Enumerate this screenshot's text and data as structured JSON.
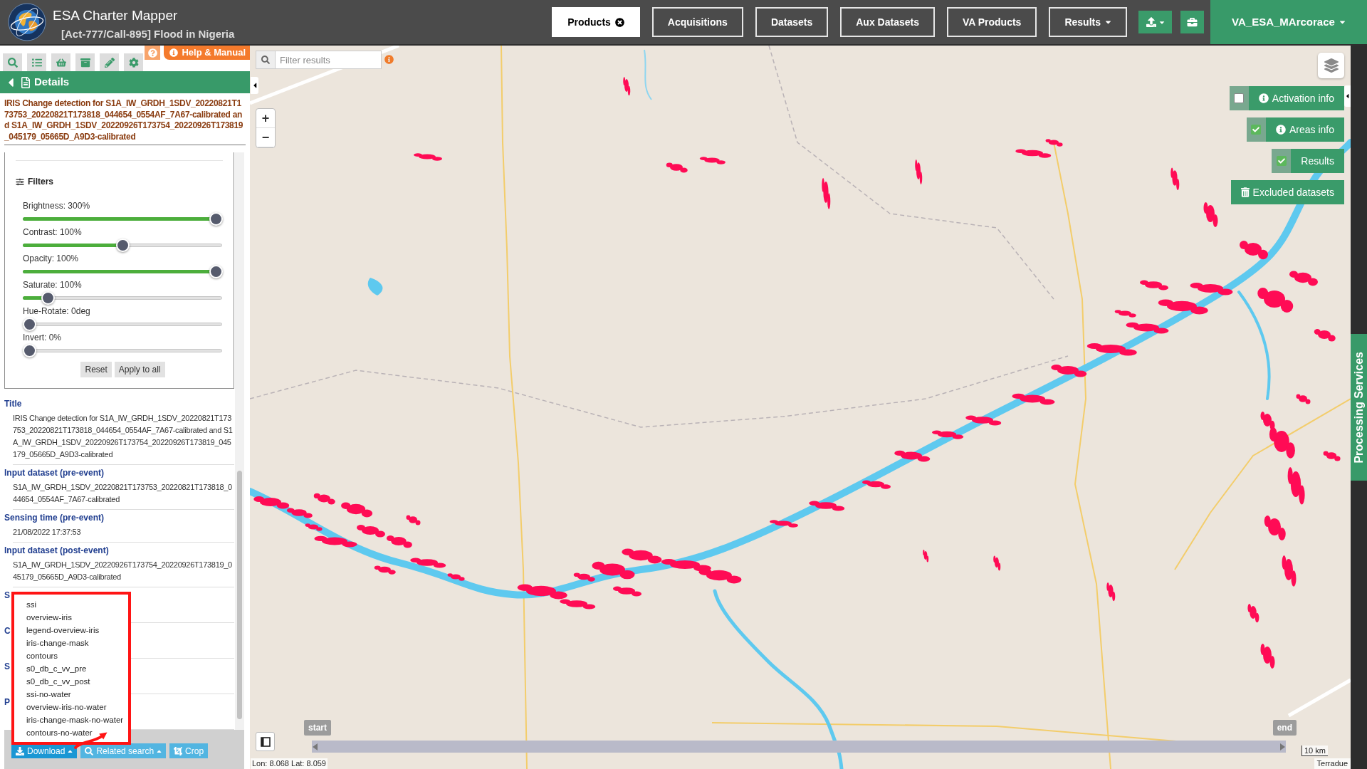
{
  "header": {
    "title": "ESA Charter Mapper",
    "subtitle": "[Act-777/Call-895] Flood in Nigeria"
  },
  "nav": [
    {
      "label": "Products",
      "selected": true,
      "kind": "closable"
    },
    {
      "label": "Acquisitions",
      "selected": false,
      "kind": "tab"
    },
    {
      "label": "Datasets",
      "selected": false,
      "kind": "tab"
    },
    {
      "label": "Aux Datasets",
      "selected": false,
      "kind": "tab"
    },
    {
      "label": "VA Products",
      "selected": false,
      "kind": "tab"
    },
    {
      "label": "Results",
      "selected": false,
      "kind": "menu"
    }
  ],
  "user": {
    "label": "VA_ESA_MArcorace"
  },
  "left_panel": {
    "help": {
      "label": "Help & Manual"
    },
    "details": {
      "label": "Details"
    },
    "product_title": "IRIS Change detection for S1A_IW_GRDH_1SDV_20220821T173753_20220821T173818_044654_0554AF_7A67-calibrated and S1A_IW_GRDH_1SDV_20220926T173754_20220926T173819_045179_05665D_A9D3-calibrated",
    "filters": {
      "title": "Filters",
      "sliders": [
        {
          "label": "Brightness: 300%",
          "level": 1
        },
        {
          "label": "Contrast: 100%",
          "level": 0.5
        },
        {
          "label": "Opacity: 100%",
          "level": 1
        },
        {
          "label": "Saturate: 100%",
          "level": 0.1
        },
        {
          "label": "Hue-Rotate: 0deg",
          "level": 0
        },
        {
          "label": "Invert: 0%",
          "level": 0
        }
      ],
      "buttons": [
        "Reset",
        "Apply to all"
      ]
    },
    "fields": [
      {
        "label": "Title",
        "value": "IRIS Change detection for S1A_IW_GRDH_1SDV_20220821T173753_20220821T173818_044654_0554AF_7A67-calibrated and S1A_IW_GRDH_1SDV_20220926T173754_20220926T173819_045179_05665D_A9D3-calibrated"
      },
      {
        "label": "Input dataset (pre-event)",
        "value": "S1A_IW_GRDH_1SDV_20220821T173753_20220821T173818_044654_0554AF_7A67-calibrated"
      },
      {
        "label": "Sensing time (pre-event)",
        "value": "21/08/2022 17:37:53"
      },
      {
        "label": "Input dataset (post-event)",
        "value": "S1A_IW_GRDH_1SDV_20220926T173754_20220926T173819_045179_05665D_A9D3-calibrated"
      },
      {
        "label": "S"
      },
      {
        "label": "C"
      },
      {
        "label": "S"
      },
      {
        "label": "P"
      }
    ],
    "actions": [
      {
        "label": "Download",
        "kind": "menu",
        "expanded": true
      },
      {
        "label": "Related search",
        "kind": "menu",
        "expanded": false
      },
      {
        "label": "Crop",
        "kind": "plain"
      }
    ],
    "download_menu": [
      "ssi",
      "overview-iris",
      "legend-overview-iris",
      "iris-change-mask",
      "contours",
      "s0_db_c_vv_pre",
      "s0_db_c_vv_post",
      "ssi-no-water",
      "overview-iris-no-water",
      "iris-change-mask-no-water",
      "contours-no-water"
    ]
  },
  "map": {
    "filter": {
      "placeholder": "Filter results"
    },
    "zoom": [
      "+",
      "−"
    ],
    "layer_toggles": [
      {
        "label": "Activation info",
        "kind": "info-toggle",
        "checked": false
      },
      {
        "label": "Areas info",
        "kind": "info-toggle",
        "checked": true
      },
      {
        "label": "Results",
        "kind": "toggle",
        "checked": true
      },
      {
        "label": "Excluded datasets",
        "kind": "action"
      }
    ],
    "timeline": {
      "start": "start",
      "end": "end"
    },
    "coordinates": "Lon: 8.068 Lat: 8.059",
    "scale": "10 km",
    "attribution": "Terradue"
  },
  "side_tab": {
    "label": "Processing Services"
  }
}
